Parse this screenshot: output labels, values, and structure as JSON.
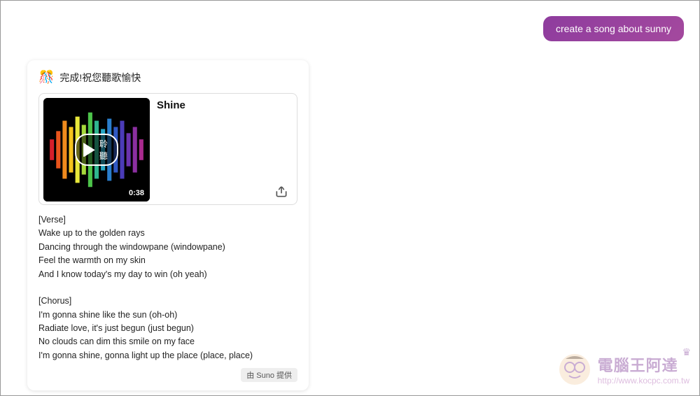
{
  "user_prompt": "create a song about sunny",
  "card": {
    "head_text": "完成!祝您聽歌愉快",
    "song_title": "Shine",
    "play_label": "聆聽",
    "duration": "0:38",
    "provider_label": "由 Suno 提供",
    "lyrics": "[Verse]\nWake up to the golden rays\nDancing through the windowpane (windowpane)\nFeel the warmth on my skin\nAnd I know today's my day to win (oh yeah)\n\n[Chorus]\nI'm gonna shine like the sun (oh-oh)\nRadiate love, it's just begun (just begun)\nNo clouds can dim this smile on my face\nI'm gonna shine, gonna light up the place (place, place)"
  },
  "watermark": {
    "title": "電腦王阿達",
    "url": "http://www.kocpc.com.tw"
  }
}
